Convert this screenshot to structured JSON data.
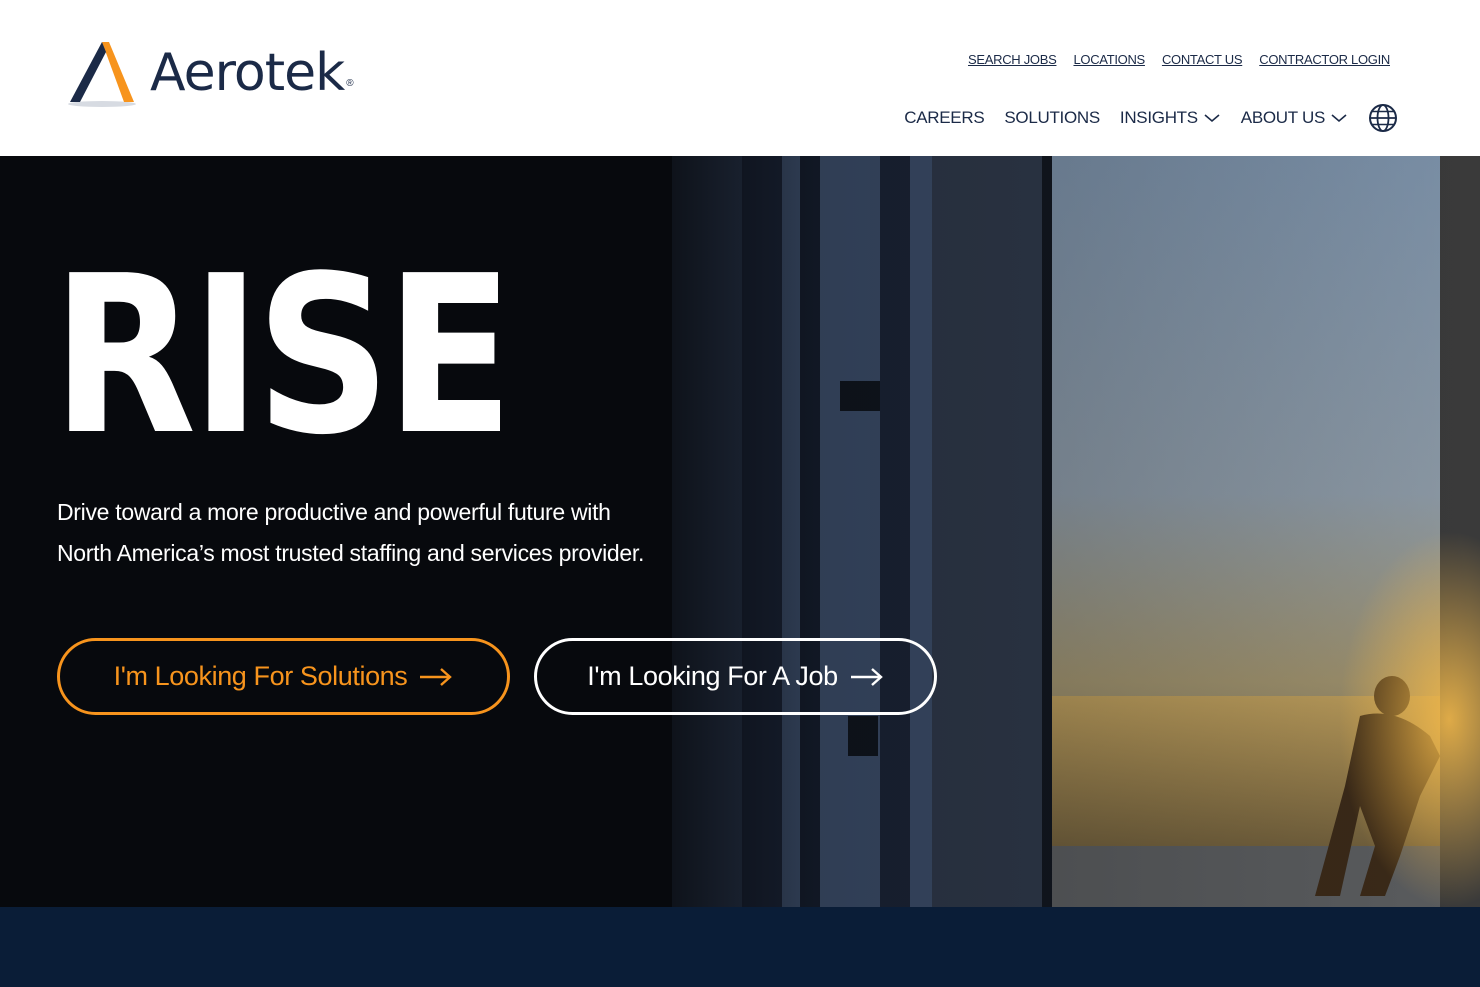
{
  "brand": {
    "name": "Aerotek",
    "registered": "®",
    "colors": {
      "navy": "#1b2a47",
      "orange": "#f7941d",
      "dark_band": "#0a1d37"
    }
  },
  "utility_nav": [
    "SEARCH JOBS",
    "LOCATIONS",
    "CONTACT US",
    "CONTRACTOR LOGIN"
  ],
  "main_nav": {
    "careers": "CAREERS",
    "solutions": "SOLUTIONS",
    "insights": "INSIGHTS",
    "about": "ABOUT US",
    "language_icon": "globe-icon"
  },
  "hero": {
    "title": "RISE",
    "subtitle_line1": "Drive toward a more productive and powerful future with",
    "subtitle_line2": "North America’s most trusted staffing and services provider.",
    "cta_solutions": "I'm Looking For Solutions",
    "cta_job": "I'm Looking For A Job",
    "arrow_icon": "arrow-right-icon"
  }
}
